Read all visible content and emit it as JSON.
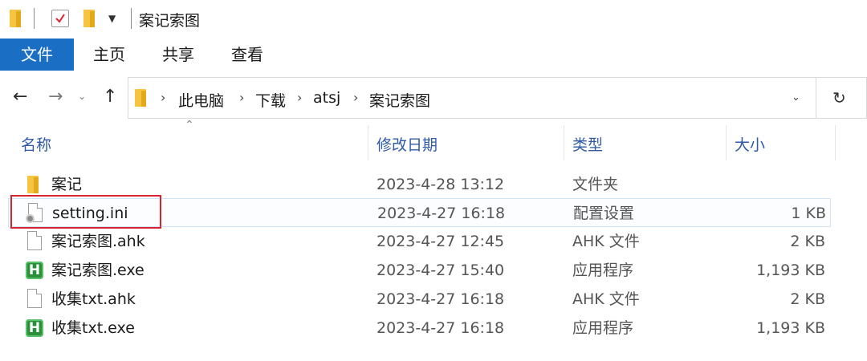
{
  "window": {
    "title": "案记索图"
  },
  "ribbon": {
    "tabs": [
      "文件",
      "主页",
      "共享",
      "查看"
    ]
  },
  "address": {
    "path": [
      "此电脑",
      "下载",
      "atsj",
      "案记索图"
    ]
  },
  "columns": {
    "name": "名称",
    "modified": "修改日期",
    "type": "类型",
    "size": "大小"
  },
  "files": [
    {
      "name": "案记",
      "modified": "2023-4-28 13:12",
      "type": "文件夹",
      "size": "",
      "icon": "folder-icon"
    },
    {
      "name": "setting.ini",
      "modified": "2023-4-27 16:18",
      "type": "配置设置",
      "size": "1 KB",
      "icon": "settings-file-icon"
    },
    {
      "name": "案记索图.ahk",
      "modified": "2023-4-27 12:45",
      "type": "AHK 文件",
      "size": "2 KB",
      "icon": "file-icon"
    },
    {
      "name": "案记索图.exe",
      "modified": "2023-4-27 15:40",
      "type": "应用程序",
      "size": "1,193 KB",
      "icon": "exe-icon"
    },
    {
      "name": "收集txt.ahk",
      "modified": "2023-4-27 16:18",
      "type": "AHK 文件",
      "size": "2 KB",
      "icon": "file-icon"
    },
    {
      "name": "收集txt.exe",
      "modified": "2023-4-27 16:18",
      "type": "应用程序",
      "size": "1,193 KB",
      "icon": "exe-icon"
    }
  ],
  "colors": {
    "accent": "#1a6fc5",
    "header_text": "#2e5aa8",
    "highlight": "#d9232e",
    "folder": "#f5c542"
  }
}
